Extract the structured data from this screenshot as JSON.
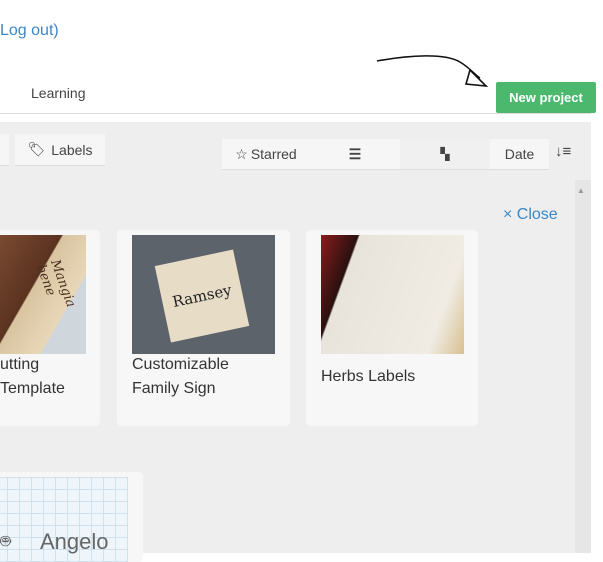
{
  "header": {
    "logout_link": "Log out)",
    "nav_learning": "Learning",
    "new_project": "New project"
  },
  "toolbar": {
    "labels": "Labels",
    "starred": "Starred",
    "sort_by": "Date"
  },
  "panel": {
    "close": "× Close"
  },
  "projects": [
    {
      "title_line1": "utting",
      "title_line2": "Template",
      "image_text": "Mangia bene"
    },
    {
      "title_line1": "Customizable",
      "title_line2": "Family Sign",
      "image_text": "Ramsey"
    },
    {
      "title_line1": "Herbs Labels"
    },
    {
      "title_line1": "Angelo"
    }
  ],
  "colors": {
    "accent": "#4cb86d",
    "link": "#3a87c8"
  }
}
